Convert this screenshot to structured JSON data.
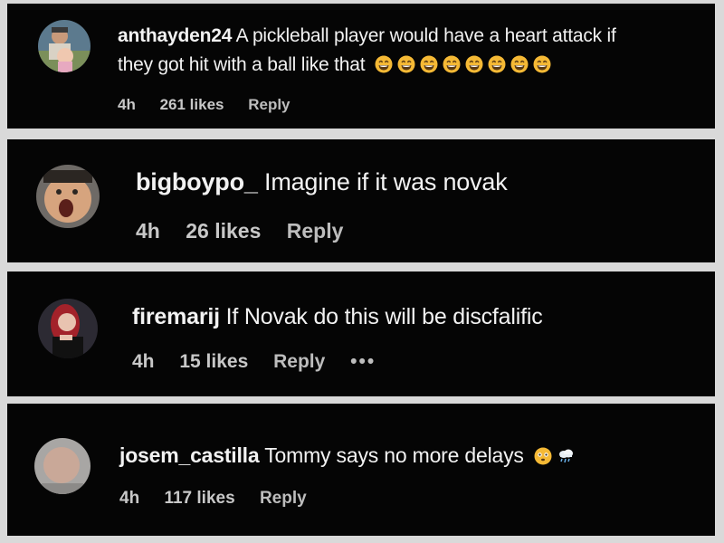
{
  "comments": [
    {
      "username": "anthayden24",
      "text_line1": "A pickleball player would have a heart attack if",
      "text_line2": "they got hit with a ball like that",
      "emojis": [
        "laughing-emoji",
        "laughing-emoji",
        "laughing-emoji",
        "laughing-emoji",
        "laughing-emoji",
        "laughing-emoji",
        "laughing-emoji",
        "laughing-emoji"
      ],
      "time": "4h",
      "likes": "261 likes",
      "reply": "Reply"
    },
    {
      "username": "bigboypo_",
      "text": "Imagine if it was novak",
      "time": "4h",
      "likes": "26 likes",
      "reply": "Reply"
    },
    {
      "username": "firemarij",
      "text": "If Novak do this will be discfalific",
      "time": "4h",
      "likes": "15 likes",
      "reply": "Reply",
      "more": "•••"
    },
    {
      "username": "josem_castilla",
      "text": "Tommy says no more delays",
      "emojis": [
        "flushed-emoji",
        "cloud-rain-emoji"
      ],
      "time": "4h",
      "likes": "117 likes",
      "reply": "Reply"
    }
  ],
  "colors": {
    "background": "#050505",
    "separator": "#d9d9d9",
    "text": "#f2f2f2",
    "meta": "#c8c8c8",
    "emoji": "#f5b935"
  }
}
